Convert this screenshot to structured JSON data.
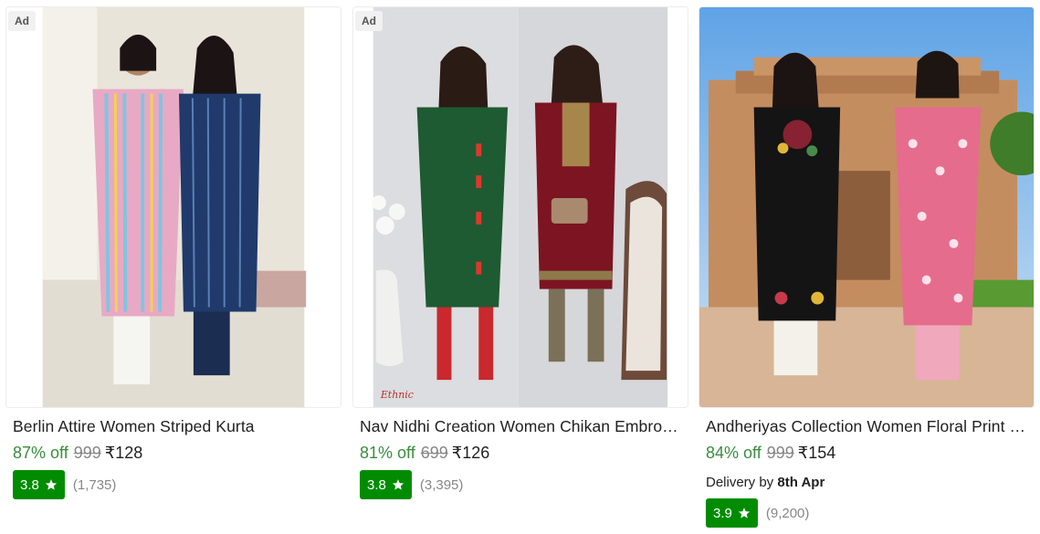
{
  "colors": {
    "discount": "#388e3c",
    "rating_badge": "#008c00",
    "muted_text": "#878787"
  },
  "products": [
    {
      "ad_label": "Ad",
      "title": "Berlin Attire Women Striped Kurta",
      "discount": "87% off",
      "mrp": "999",
      "price": "₹128",
      "rating": "3.8",
      "rating_icon": "star-icon",
      "rating_count": "(1,735)"
    },
    {
      "ad_label": "Ad",
      "title": "Nav Nidhi Creation Women Chikan Embroidery Kurta",
      "discount": "81% off",
      "mrp": "699",
      "price": "₹126",
      "rating": "3.8",
      "rating_icon": "star-icon",
      "rating_count": "(3,395)",
      "image_watermark": "Ethnic"
    },
    {
      "title": "Andheriyas Collection Women Floral Print Kurta",
      "discount": "84% off",
      "mrp": "999",
      "price": "₹154",
      "delivery_prefix": "Delivery by",
      "delivery_date": "8th Apr",
      "rating": "3.9",
      "rating_icon": "star-icon",
      "rating_count": "(9,200)"
    }
  ]
}
